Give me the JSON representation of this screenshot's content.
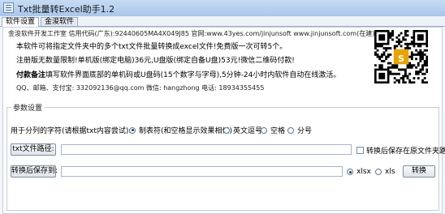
{
  "window": {
    "title": "Txt批量转Excel助手1.2"
  },
  "tabs": [
    {
      "label": "软件设置",
      "active": true
    },
    {
      "label": "金浚软件",
      "active": false
    }
  ],
  "info": {
    "line1": "金浚软件开发工作室 信用代码(广东):92440605MA4X049J85 官网:www.43yes.com/jinjunsoft www.jinjunsoft.com(在建)",
    "line2": "本软件可将指定文件夹中的多个txt文件批量转换成excel文件!免费版一次可转5个。",
    "line3": "注册版无数量限制!单机版(绑定电脑)36元,U盘版(绑定自备U盘)53元!微信二维码付款!",
    "line4_bold": "付款备注",
    "line4_rest": "填写软件界面底部的单机码或U盘码(15个数字与字母),5分钟-24小时内软件自动在线激活。",
    "line5": "QQ、邮箱、支付宝: 332092136@qq.com  微信: hangzhong  电话: 18934355455"
  },
  "params": {
    "group_title": "参数设置",
    "split_label": "用于分列的字符(请根据txt内容尝试):",
    "split_options": [
      {
        "label": "制表符(和空格显示效果相似)",
        "selected": true
      },
      {
        "label": "英文逗号",
        "selected": false
      },
      {
        "label": "空格",
        "selected": false
      },
      {
        "label": "分号",
        "selected": false
      }
    ],
    "txt_path_button": "txt文件路径:",
    "txt_path_value": "",
    "save_same_folder_label": "转换后保存在原文件夹路径",
    "save_to_button": "转换后保存到:",
    "save_to_value": "",
    "format_options": [
      {
        "label": "xlsx",
        "selected": true
      },
      {
        "label": "xls",
        "selected": false
      }
    ],
    "convert_button": "转换"
  },
  "qr": {
    "badge_text": "S",
    "badge_color": "#e8a300"
  }
}
